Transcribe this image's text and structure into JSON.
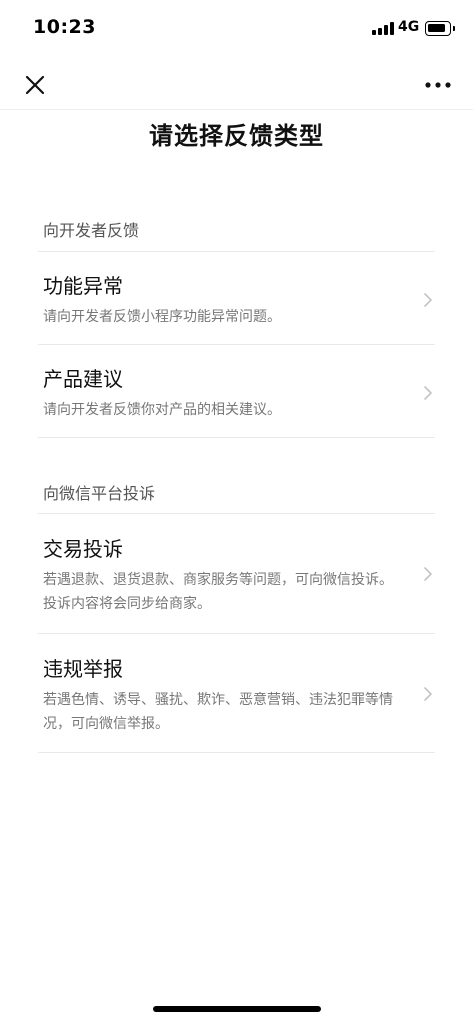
{
  "status_bar": {
    "time": "10:23",
    "network": "4G"
  },
  "nav": {
    "close_icon": "close-icon",
    "more_icon": "more-icon"
  },
  "page": {
    "title": "请选择反馈类型"
  },
  "sections": [
    {
      "header": "向开发者反馈",
      "items": [
        {
          "title": "功能异常",
          "desc": "请向开发者反馈小程序功能异常问题。"
        },
        {
          "title": "产品建议",
          "desc": "请向开发者反馈你对产品的相关建议。"
        }
      ]
    },
    {
      "header": "向微信平台投诉",
      "items": [
        {
          "title": "交易投诉",
          "desc": "若遇退款、退货退款、商家服务等问题，可向微信投诉。投诉内容将会同步给商家。"
        },
        {
          "title": "违规举报",
          "desc": "若遇色情、诱导、骚扰、欺诈、恶意营销、违法犯罪等情况，可向微信举报。"
        }
      ]
    }
  ],
  "colors": {
    "title": "#111111",
    "section_header": "#555555",
    "description": "#777777",
    "divider": "#e9e9e9",
    "chevron": "#c4c4c4"
  }
}
